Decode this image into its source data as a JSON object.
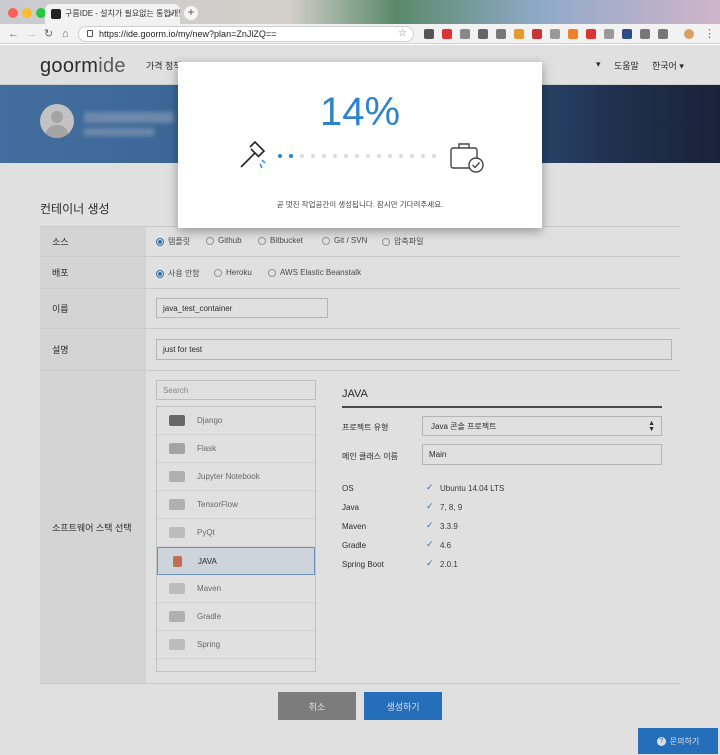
{
  "browser": {
    "tab_title": "구름IDE - 설치가 필요없는 통합개발",
    "tab_close": "×",
    "new_tab": "+",
    "url": "https://ide.goorm.io/my/new?plan=ZnJlZQ=="
  },
  "header": {
    "logo_a": "goorm",
    "logo_b": "ide",
    "nav_price": "가격 정책",
    "nav_help": "도움말",
    "nav_lang": "한국어 ▾",
    "nav_user_arrow": "▾"
  },
  "page": {
    "title": "컨테이너 생성",
    "source": {
      "label": "소스",
      "options": [
        "템플릿",
        "Github",
        "Bitbucket",
        "Git / SVN",
        "압축파일"
      ],
      "selected": 0
    },
    "deploy": {
      "label": "배포",
      "options": [
        "사용 안함",
        "Heroku",
        "AWS Elastic Beanstalk"
      ],
      "selected": 0
    },
    "name": {
      "label": "이름",
      "value": "java_test_container"
    },
    "description": {
      "label": "설명",
      "value": "just for test"
    },
    "stack": {
      "label": "소프트웨어 스택 선택",
      "search_placeholder": "Search",
      "items": [
        "Django",
        "Flask",
        "Jupyter Notebook",
        "TensorFlow",
        "PyQt",
        "JAVA",
        "Maven",
        "Gradle",
        "Spring"
      ],
      "selected_index": 5
    },
    "panel": {
      "title": "JAVA",
      "project_type_label": "프로젝트 유형",
      "project_type_value": "Java 콘솔 프로젝트",
      "main_class_label": "메인 클래스 이름",
      "main_class_value": "Main",
      "specs": [
        {
          "name": "OS",
          "value": "Ubuntu 14.04 LTS"
        },
        {
          "name": "Java",
          "value": "7, 8, 9"
        },
        {
          "name": "Maven",
          "value": "3.3.9"
        },
        {
          "name": "Gradle",
          "value": "4.6"
        },
        {
          "name": "Spring Boot",
          "value": "2.0.1"
        }
      ]
    },
    "cancel_label": "취소",
    "create_label": "생성하기",
    "help_label": "문의하기"
  },
  "modal": {
    "progress_text": "14%",
    "progress": 0.14,
    "message": "곧 멋진 작업공간이 생성됩니다. 잠시만 기다려주세요."
  },
  "colors": {
    "accent": "#2e84cc",
    "button_gray": "#8e8e8e",
    "button_blue": "#2b7fd4"
  }
}
